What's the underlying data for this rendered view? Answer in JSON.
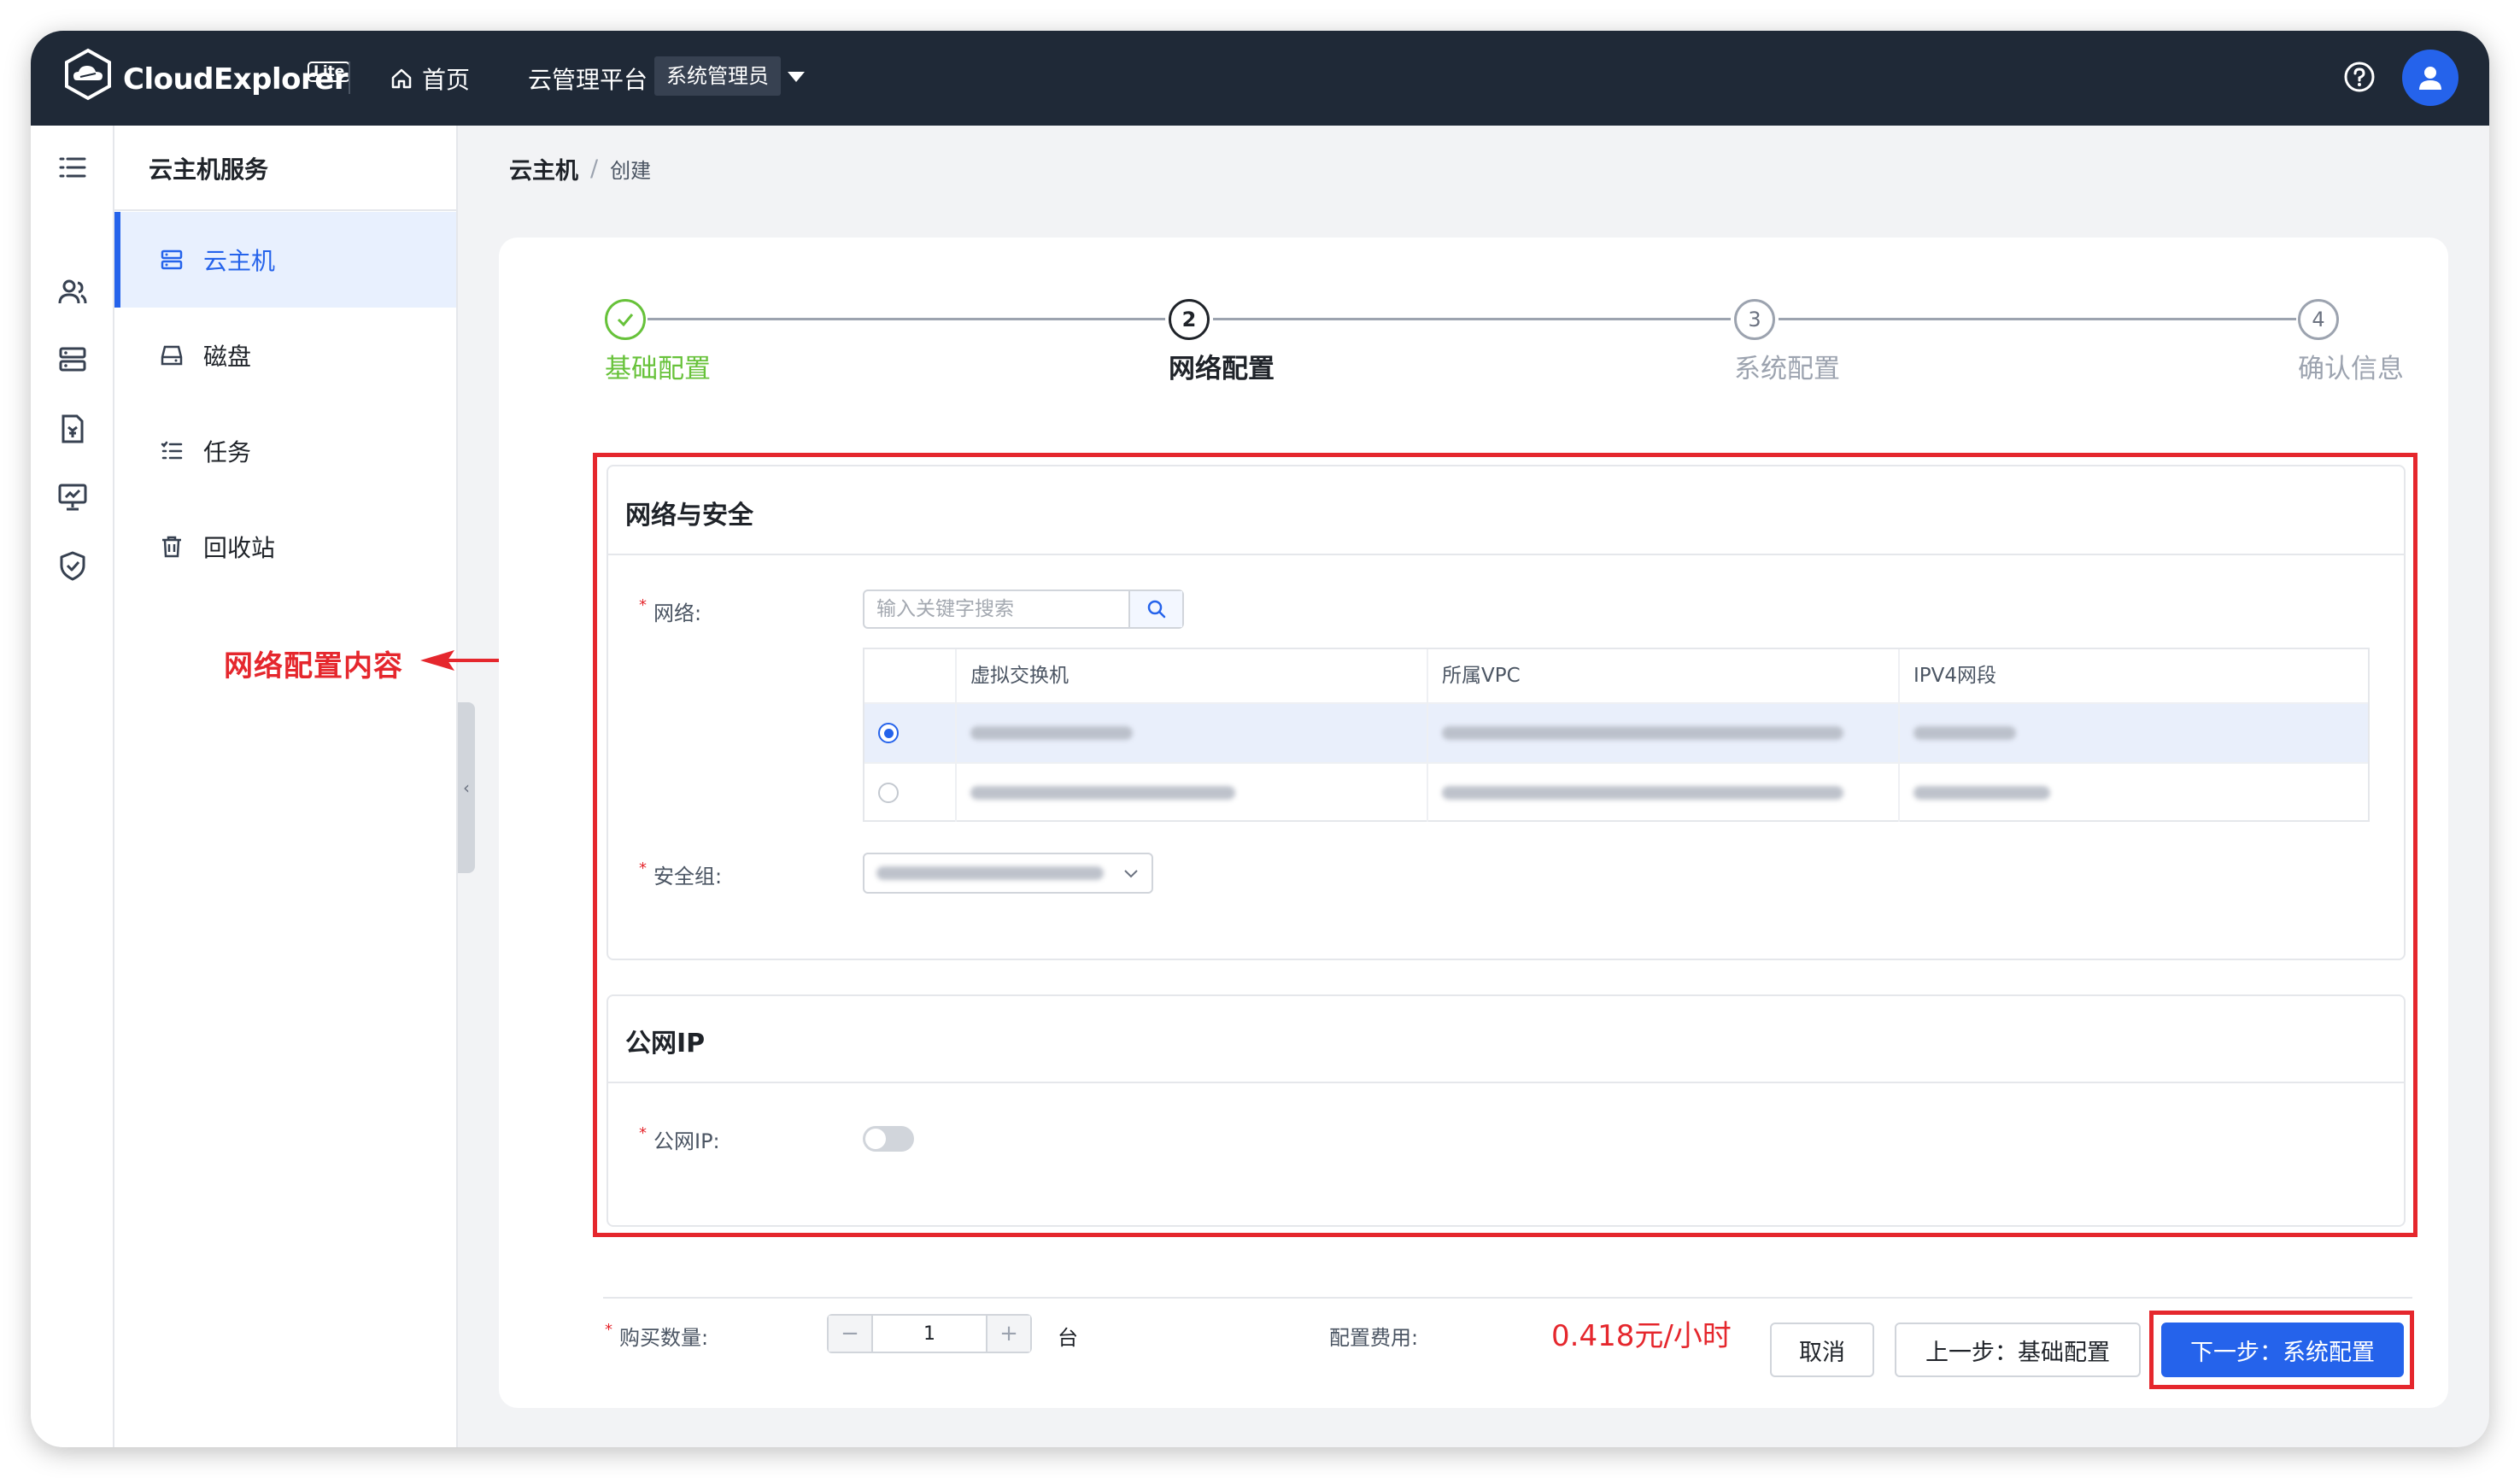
{
  "app": {
    "logo_text": "CloudExplorer",
    "logo_badge": "Lite"
  },
  "topbar": {
    "home_label": "首页",
    "platform_label": "云管理平台",
    "role_label": "系统管理员"
  },
  "sidebar": {
    "title": "云主机服务",
    "items": [
      {
        "label": "云主机",
        "icon": "server-icon",
        "active": true
      },
      {
        "label": "磁盘",
        "icon": "disk-icon"
      },
      {
        "label": "任务",
        "icon": "task-list-icon"
      },
      {
        "label": "回收站",
        "icon": "trash-icon"
      }
    ]
  },
  "annotation": {
    "text": "网络配置内容"
  },
  "breadcrumb": {
    "parent": "云主机",
    "separator": "/",
    "current": "创建"
  },
  "steps": [
    {
      "number": "✓",
      "label": "基础配置",
      "state": "done"
    },
    {
      "number": "2",
      "label": "网络配置",
      "state": "active"
    },
    {
      "number": "3",
      "label": "系统配置",
      "state": "pending"
    },
    {
      "number": "4",
      "label": "确认信息",
      "state": "pending"
    }
  ],
  "network_section": {
    "title": "网络与安全",
    "network_label": "网络:",
    "search_placeholder": "输入关键字搜索",
    "table_headers": [
      "虚拟交换机",
      "所属VPC",
      "IPV4网段"
    ],
    "security_group_label": "安全组:"
  },
  "public_ip_section": {
    "title": "公网IP",
    "label": "公网IP:",
    "enabled": false
  },
  "footer": {
    "quantity_label": "购买数量:",
    "quantity_value": "1",
    "quantity_unit": "台",
    "fee_label": "配置费用:",
    "fee_value": "0.418元/小时",
    "cancel_label": "取消",
    "prev_label": "上一步：基础配置",
    "next_label": "下一步：系统配置"
  },
  "colors": {
    "accent": "#2563eb",
    "highlight_red": "#e5272d",
    "done_green": "#67c23a",
    "topbar": "#1f2937"
  }
}
